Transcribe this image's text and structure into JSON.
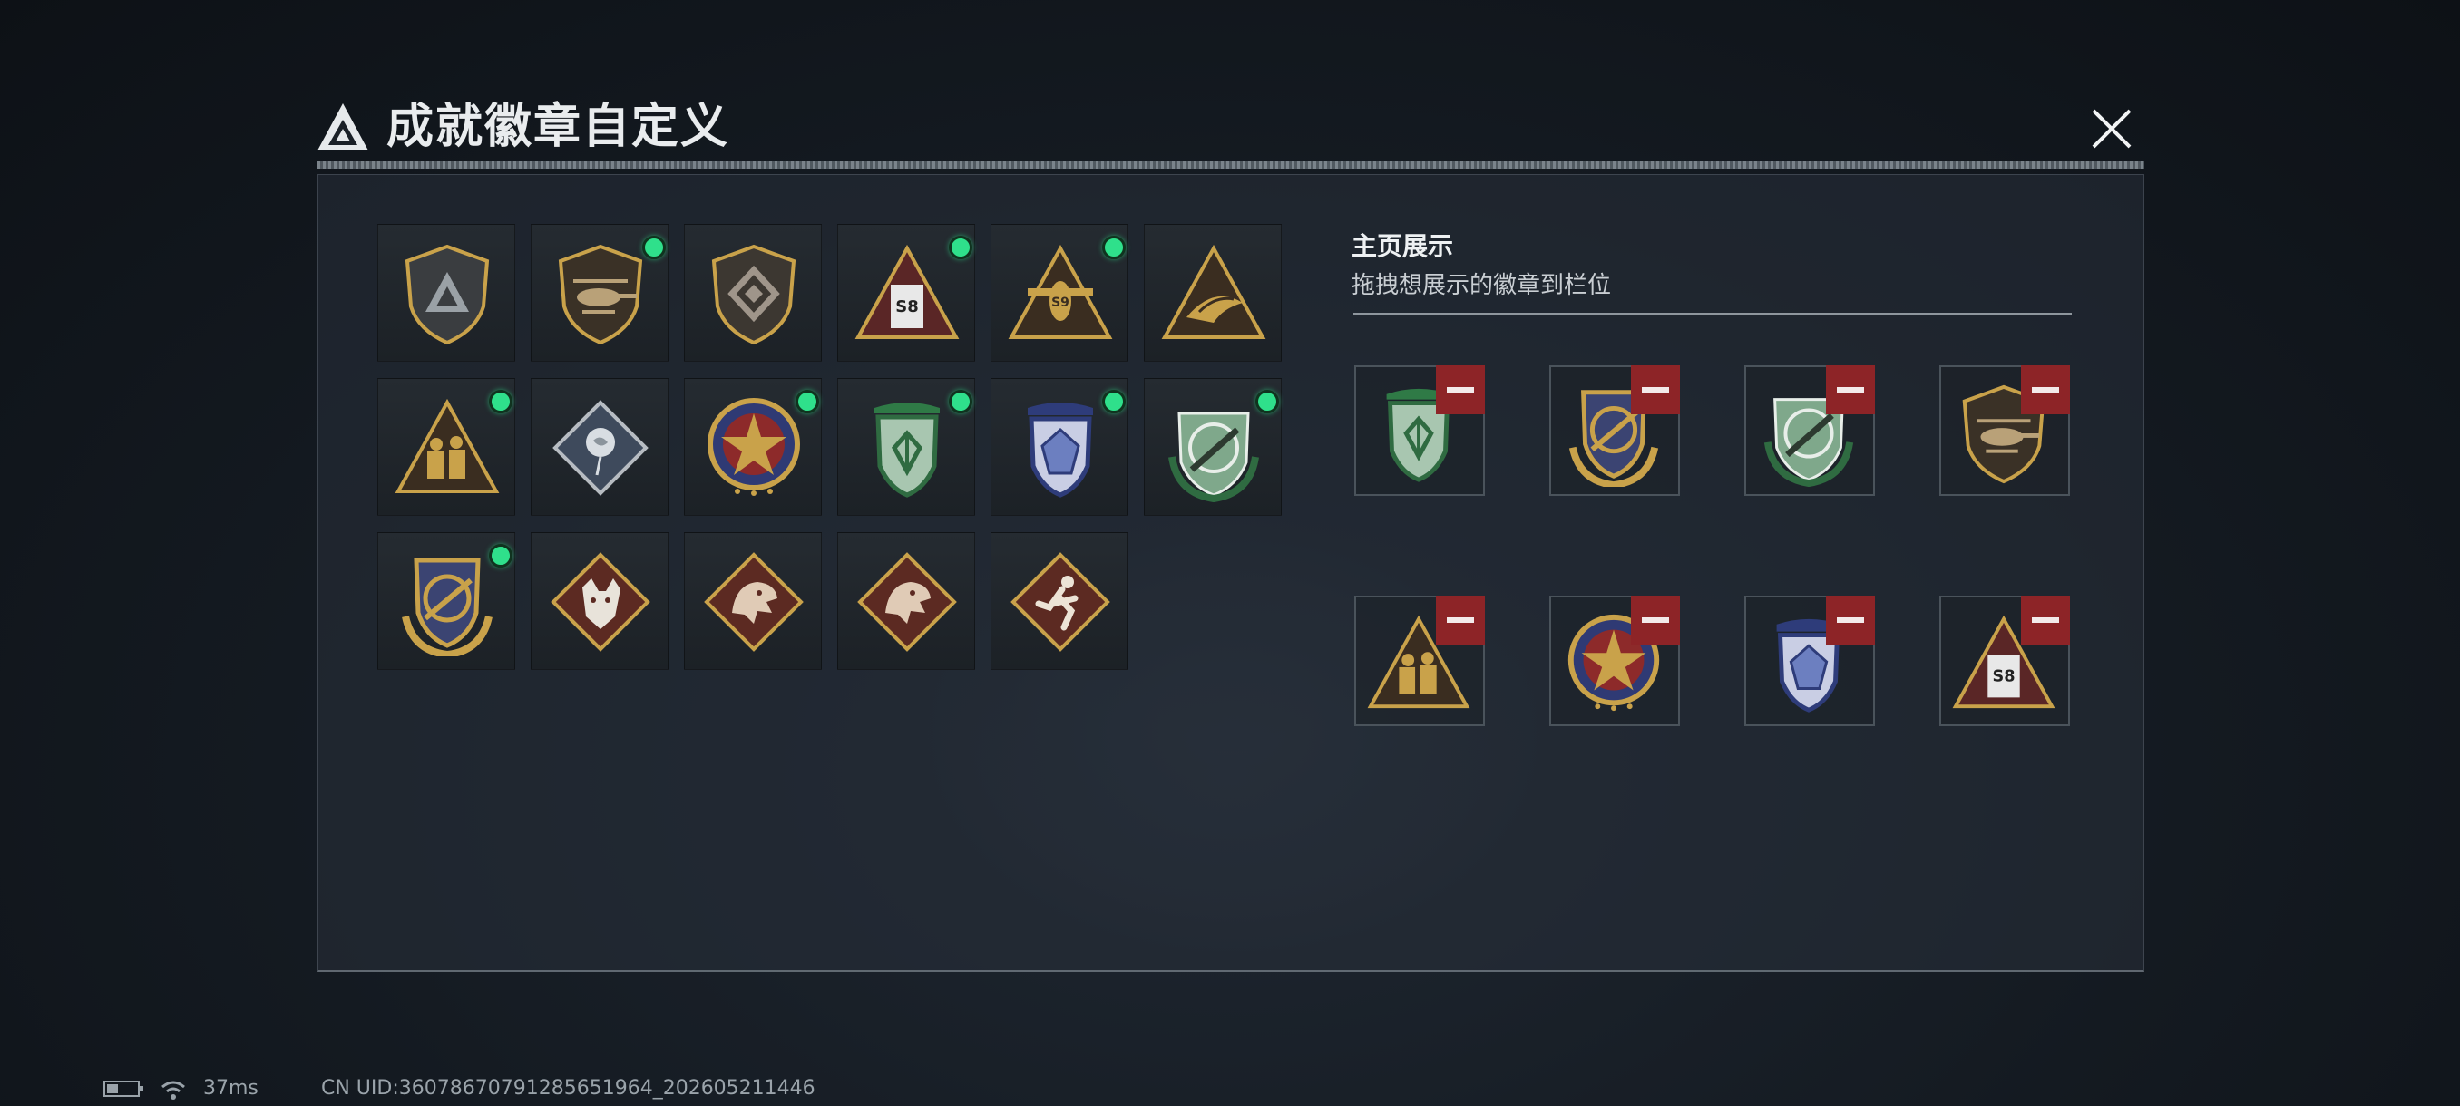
{
  "header": {
    "title": "成就徽章自定义"
  },
  "badge_grid": [
    {
      "icon": "triangle-logo-shield-badge",
      "new": false
    },
    {
      "icon": "helicopter-shield-badge",
      "new": true
    },
    {
      "icon": "diamond-emblem-shield-badge",
      "new": false
    },
    {
      "icon": "s8-building-triangle-badge",
      "new": true
    },
    {
      "icon": "s9-aircraft-triangle-badge",
      "new": true
    },
    {
      "icon": "bird-triangle-badge",
      "new": false
    },
    {
      "icon": "soldiers-triangle-badge",
      "new": true
    },
    {
      "icon": "rose-diamond-badge",
      "new": false
    },
    {
      "icon": "star-medal-badge",
      "new": true
    },
    {
      "icon": "green-rune-shield-badge",
      "new": true
    },
    {
      "icon": "blue-crystal-shield-badge",
      "new": true
    },
    {
      "icon": "green-rifle-shield-badge",
      "new": true
    },
    {
      "icon": "crosshair-gold-shield-badge",
      "new": true
    },
    {
      "icon": "wolf-diamond-badge",
      "new": false
    },
    {
      "icon": "dragon-diamond-badge",
      "new": false
    },
    {
      "icon": "dragon-diamond-badge-2",
      "new": false
    },
    {
      "icon": "runner-diamond-badge",
      "new": false
    }
  ],
  "showcase": {
    "title": "主页展示",
    "subtitle": "拖拽想展示的徽章到栏位",
    "slots": [
      {
        "icon": "green-rune-shield-badge"
      },
      {
        "icon": "crosshair-gold-shield-badge"
      },
      {
        "icon": "green-rifle-shield-badge"
      },
      {
        "icon": "helicopter-shield-badge"
      },
      {
        "icon": "soldiers-triangle-badge"
      },
      {
        "icon": "star-medal-badge"
      },
      {
        "icon": "blue-crystal-shield-badge"
      },
      {
        "icon": "s8-building-triangle-badge"
      }
    ]
  },
  "status": {
    "ping": "37ms",
    "uid": "CN UID:3607867079128565196​4_202605211446"
  },
  "colors": {
    "new_dot": "#2fe08b",
    "remove_button": "#8d2427",
    "gold": "#c9a24a"
  }
}
